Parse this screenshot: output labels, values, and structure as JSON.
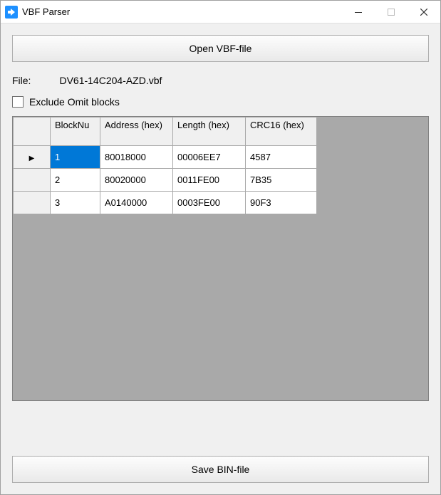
{
  "window": {
    "title": "VBF Parser"
  },
  "buttons": {
    "open": "Open VBF-file",
    "save": "Save BIN-file"
  },
  "fileRow": {
    "label": "File:",
    "value": "DV61-14C204-AZD.vbf"
  },
  "exclude": {
    "label": "Exclude Omit blocks",
    "checked": false
  },
  "grid": {
    "headers": {
      "blocknum": "BlockNu",
      "address": "Address (hex)",
      "length": "Length (hex)",
      "crc": "CRC16 (hex)"
    },
    "rows": [
      {
        "n": "1",
        "addr": "80018000",
        "len": "00006EE7",
        "crc": "4587",
        "current": true,
        "selected": "n"
      },
      {
        "n": "2",
        "addr": "80020000",
        "len": "0011FE00",
        "crc": "7B35",
        "current": false
      },
      {
        "n": "3",
        "addr": "A0140000",
        "len": "0003FE00",
        "crc": "90F3",
        "current": false
      }
    ]
  }
}
